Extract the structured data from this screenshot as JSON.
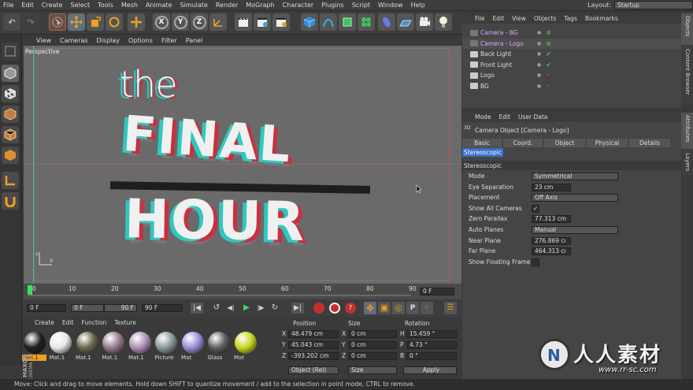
{
  "menu": {
    "items": [
      "File",
      "Edit",
      "Create",
      "Select",
      "Tools",
      "Mesh",
      "Animate",
      "Simulate",
      "Render",
      "MoGraph",
      "Character",
      "Plugins",
      "Script",
      "Window",
      "Help"
    ],
    "layout_label": "Layout:",
    "layout_value": "Startup"
  },
  "toolbar": {
    "x": "X",
    "y": "Y",
    "z": "Z"
  },
  "viewport": {
    "menu": [
      "View",
      "Cameras",
      "Display",
      "Options",
      "Filter",
      "Panel"
    ],
    "label": "Perspective",
    "title_line1": "the",
    "title_line2": "FINAL",
    "title_line3": "HOUR"
  },
  "timeline": {
    "ticks": [
      "0",
      "10",
      "20",
      "30",
      "40",
      "50",
      "60",
      "70",
      "80",
      "90"
    ],
    "frame_end": "0 F"
  },
  "transport": {
    "start": "0 F",
    "range_start": "0 F",
    "range_end": "90 F",
    "end": "90 F"
  },
  "materials": {
    "menu": [
      "Create",
      "Edit",
      "Function",
      "Texture"
    ],
    "items": [
      {
        "name": "Mat.1",
        "color": "#202020"
      },
      {
        "name": "Mat.1",
        "color": "#e8e8e8"
      },
      {
        "name": "Mat.1",
        "color": "#6a6a50"
      },
      {
        "name": "Mat.1",
        "color": "#9a7a90"
      },
      {
        "name": "Mat.1",
        "color": "#b090b8"
      },
      {
        "name": "Picture",
        "color": "#8a9a9a"
      },
      {
        "name": "Mat",
        "color": "#9a90d8"
      },
      {
        "name": "Glass",
        "color": "#606060"
      },
      {
        "name": "Mat",
        "color": "#c8d820"
      }
    ]
  },
  "coordinates": {
    "headers": [
      "Position",
      "Size",
      "Rotation"
    ],
    "rows": [
      {
        "axis": "X",
        "pos": "48.479 cm",
        "size": "0 cm",
        "rlabel": "H",
        "rot": "15.459 °"
      },
      {
        "axis": "Y",
        "pos": "45.043 cm",
        "size": "0 cm",
        "rlabel": "P",
        "rot": "4.73 °"
      },
      {
        "axis": "Z",
        "pos": "-393.202 cm",
        "size": "0 cm",
        "rlabel": "B",
        "rot": "0 °"
      }
    ],
    "mode": "Object (Rel)",
    "size_mode": "Size",
    "apply": "Apply"
  },
  "objects": {
    "menu": [
      "File",
      "Edit",
      "View",
      "Objects",
      "Tags",
      "Bookmarks"
    ],
    "items": [
      {
        "name": "Camera - BG",
        "color": "#e0a0ff"
      },
      {
        "name": "Camera - Logo",
        "color": "#e0a0ff"
      },
      {
        "name": "Back Light",
        "color": "#dddddd"
      },
      {
        "name": "Front Light",
        "color": "#dddddd"
      },
      {
        "name": "Logo",
        "color": "#dddddd"
      },
      {
        "name": "BG",
        "color": "#dddddd"
      }
    ]
  },
  "attributes": {
    "menu": [
      "Mode",
      "Edit",
      "User Data"
    ],
    "title": "Camera Object [Camera - Logo]",
    "tabs": [
      "Basic",
      "Coord.",
      "Object",
      "Physical",
      "Details"
    ],
    "active_tab": "Stereoscopic",
    "section": "Stereoscopic",
    "props": [
      {
        "label": "Mode",
        "value": "Symmetrical"
      },
      {
        "label": "Eye Separation",
        "value": "23 cm"
      },
      {
        "label": "Placement",
        "value": "Off Axis"
      },
      {
        "label": "Show All Cameras",
        "value": "✔"
      },
      {
        "label": "Zero Parallax",
        "value": "77.313 cm"
      },
      {
        "label": "Auto Planes",
        "value": "Manual"
      },
      {
        "label": "Near Plane",
        "value": "276.869 cı"
      },
      {
        "label": "Far Plane",
        "value": "464.313 cı"
      },
      {
        "label": "Show Floating Frame",
        "value": ""
      }
    ]
  },
  "right_tabs": [
    "Objects",
    "Content Browser",
    "Attributes",
    "Layers"
  ],
  "status": "Move: Click and drag to move elements. Hold down SHIFT to quantize movement / add to the selection in point mode, CTRL to remove.",
  "watermark": {
    "cn": "人人素材",
    "url": "www.rr-sc.com"
  },
  "brand": {
    "line1": "MAXON",
    "line2": "CINEMA 4D"
  }
}
